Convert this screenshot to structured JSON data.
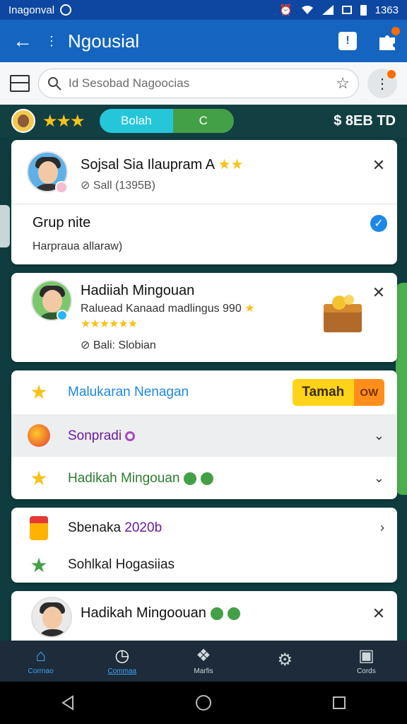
{
  "status_bar": {
    "carrier": "Inagonval",
    "time": "1363"
  },
  "app_bar": {
    "title": "Ngousial"
  },
  "search": {
    "placeholder": "Id Sesobad Nagoocias"
  },
  "game_header": {
    "segment_left": "Bolah",
    "segment_right": "C",
    "coins": "$ 8EB TD"
  },
  "profile_card": {
    "name": "Sojsal Sia Ilaupram A",
    "meta": "Sall (1395B)",
    "group_title": "Grup nite",
    "group_sub": "Harpraua allaraw)"
  },
  "reward_card": {
    "title": "Hadiiah Mingouan",
    "desc": "Raluead Kanaad madlingus 990",
    "rating_stars": "★★★★★★",
    "status": "Bali: Slobian"
  },
  "menu_card": {
    "row1_label": "Malukaran Nenagan",
    "row1_button_a": "Tamah",
    "row1_button_b": "OW",
    "row2_label": "Sonpradi",
    "row3_label": "Hadikah Mingouan"
  },
  "items_card": {
    "row1_label": "Sbenaka",
    "row1_year": "2020b",
    "row2_label": "Sohlkal Hogasiias"
  },
  "last_card": {
    "title": "Hadikah Mingoouan"
  },
  "bottom_nav": {
    "items": [
      {
        "label": "Corrnao"
      },
      {
        "label": "Commaa"
      },
      {
        "label": "Marfis"
      },
      {
        "label": ""
      },
      {
        "label": "Cords"
      }
    ]
  },
  "colors": {
    "primary": "#1565c0",
    "accent": "#ffd31a",
    "success": "#43a047"
  }
}
